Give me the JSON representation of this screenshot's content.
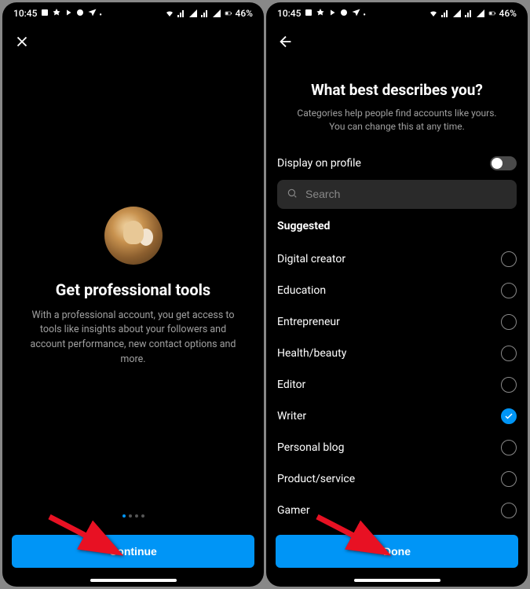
{
  "status": {
    "time": "10:45",
    "battery": "46%"
  },
  "left": {
    "title": "Get professional tools",
    "subtitle": "With a professional account, you get access to tools like insights about your followers and account performance, new contact options and more.",
    "button": "Continue"
  },
  "right": {
    "title": "What best describes you?",
    "subtitle": "Categories help people find accounts like yours. You can change this at any time.",
    "display_label": "Display on profile",
    "search_placeholder": "Search",
    "section": "Suggested",
    "categories": [
      {
        "label": "Digital creator",
        "selected": false
      },
      {
        "label": "Education",
        "selected": false
      },
      {
        "label": "Entrepreneur",
        "selected": false
      },
      {
        "label": "Health/beauty",
        "selected": false
      },
      {
        "label": "Editor",
        "selected": false
      },
      {
        "label": "Writer",
        "selected": true
      },
      {
        "label": "Personal blog",
        "selected": false
      },
      {
        "label": "Product/service",
        "selected": false
      },
      {
        "label": "Gamer",
        "selected": false
      }
    ],
    "button": "Done"
  }
}
